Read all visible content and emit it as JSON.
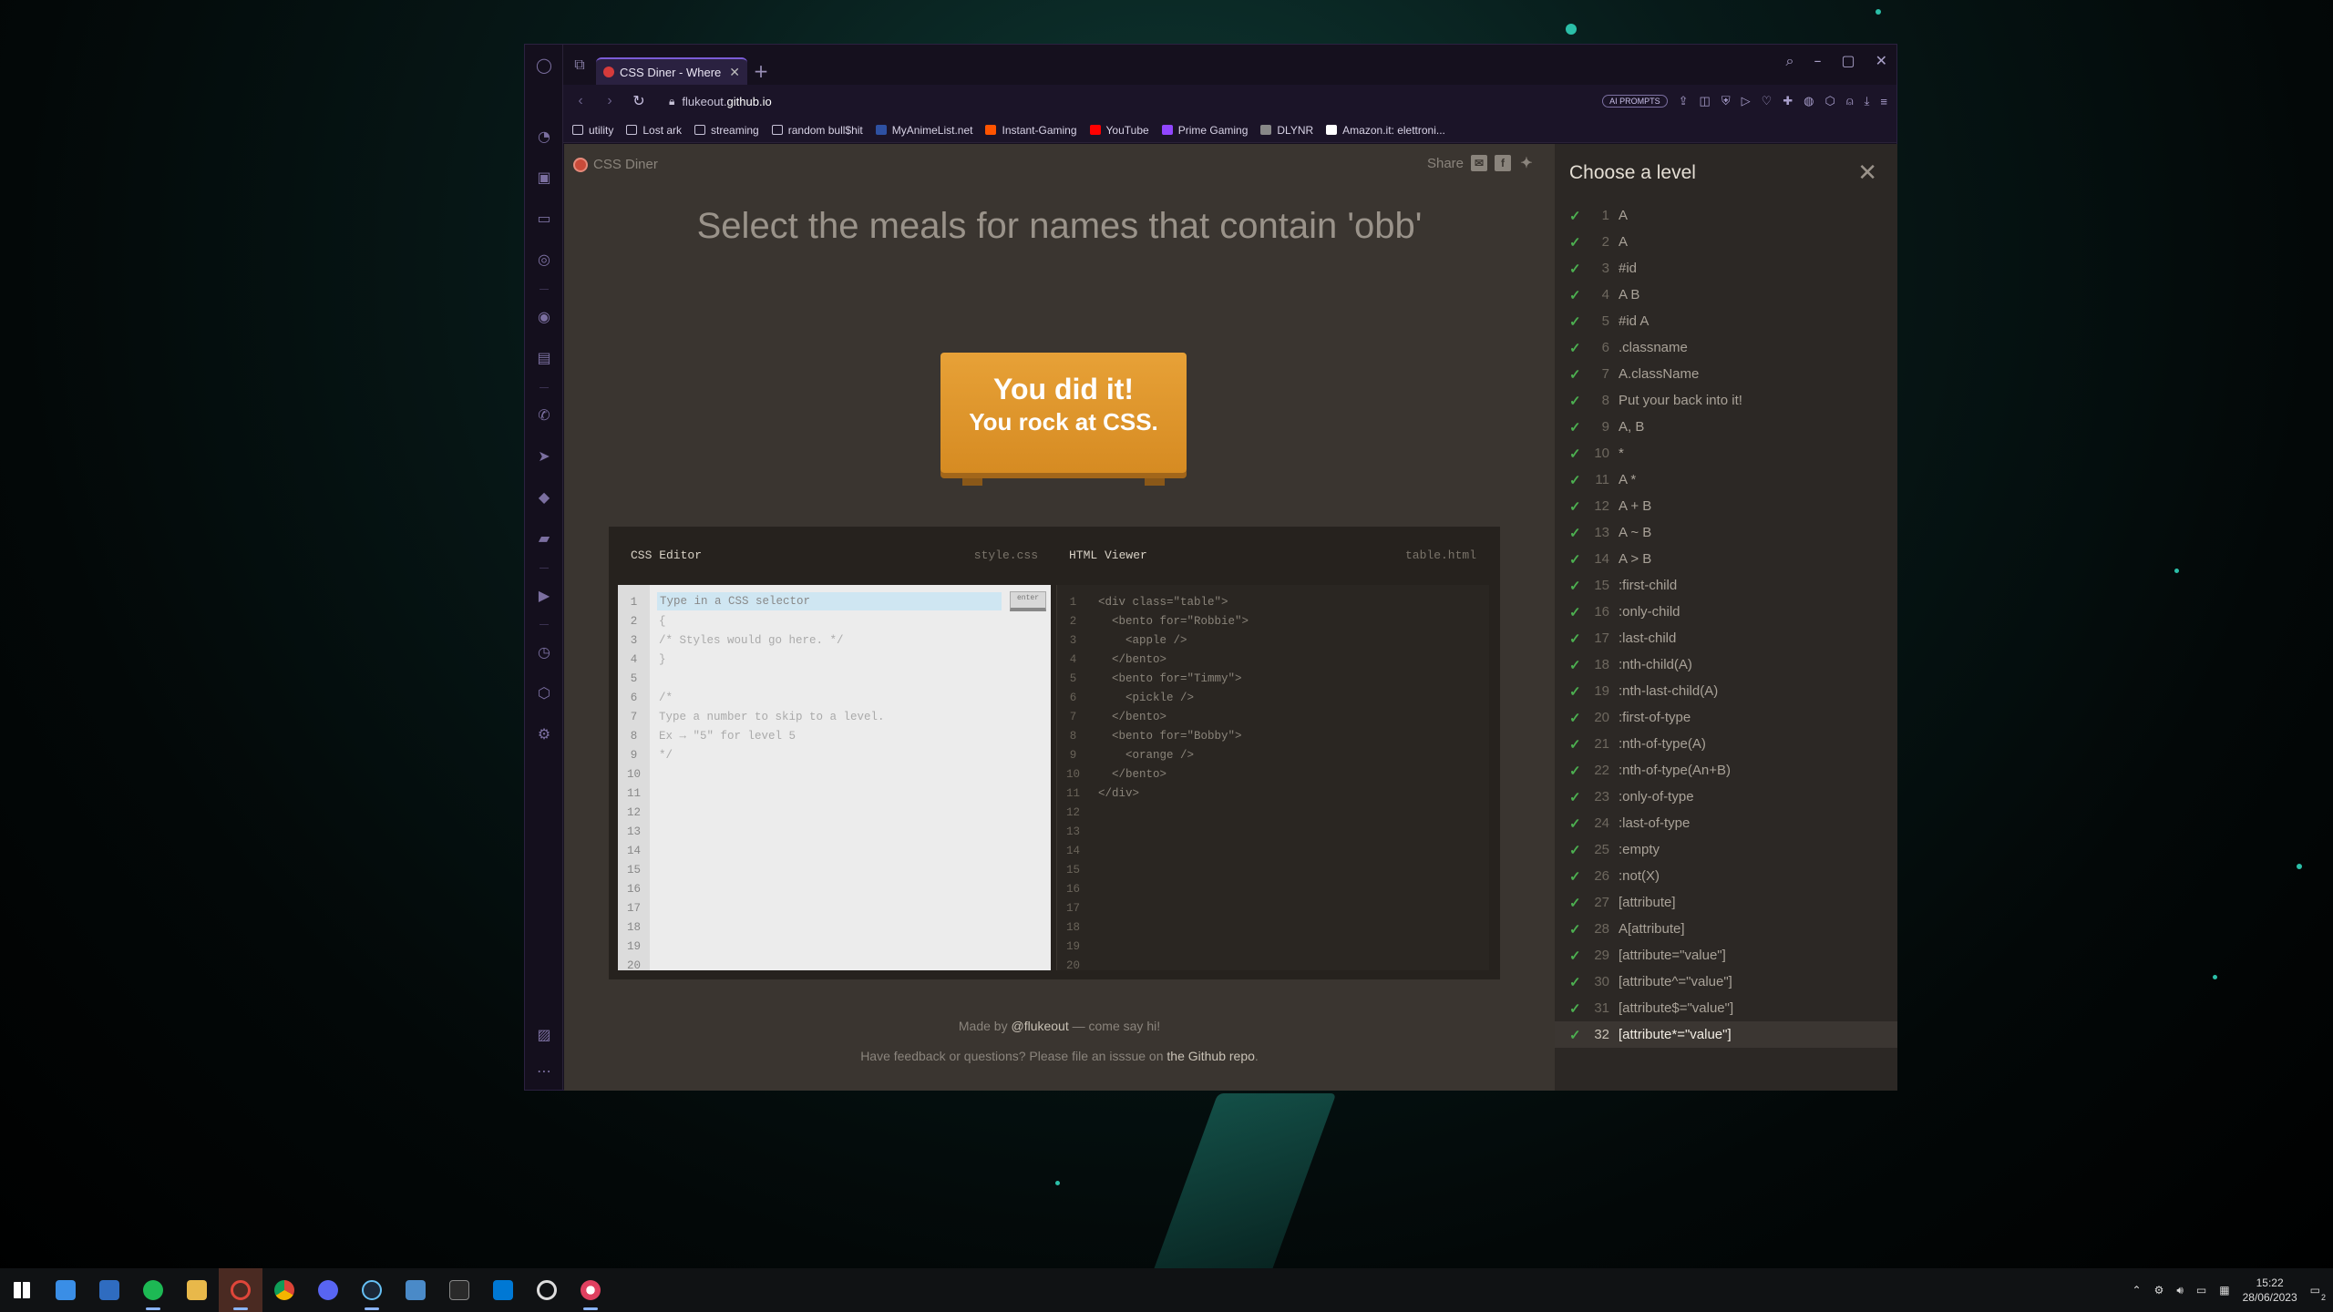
{
  "browser": {
    "tab_title": "CSS Diner - Where we feast",
    "url_prefix": "flukeout.",
    "url_domain": "github.io",
    "ai_prompts_label": "AI PROMPTS",
    "bookmarks": [
      {
        "label": "utility",
        "icon": "folder-icon"
      },
      {
        "label": "Lost ark",
        "icon": "folder-icon"
      },
      {
        "label": "streaming",
        "icon": "folder-icon"
      },
      {
        "label": "random bull$hit",
        "icon": "folder-icon"
      },
      {
        "label": "MyAnimeList.net",
        "icon": "mal-icon"
      },
      {
        "label": "Instant-Gaming",
        "icon": "instant-gaming-icon"
      },
      {
        "label": "YouTube",
        "icon": "youtube-icon"
      },
      {
        "label": "Prime Gaming",
        "icon": "prime-gaming-icon"
      },
      {
        "label": "DLYNR",
        "icon": "dlynr-icon"
      },
      {
        "label": "Amazon.it: elettroni...",
        "icon": "amazon-icon"
      }
    ]
  },
  "page": {
    "site_name": "CSS Diner",
    "share_label": "Share",
    "order_text": "Select the meals for names that contain 'obb'",
    "plate_line1": "You did it!",
    "plate_line2": "You rock at CSS.",
    "css_editor_title": "CSS Editor",
    "css_editor_file": "style.css",
    "html_viewer_title": "HTML Viewer",
    "html_viewer_file": "table.html",
    "input_placeholder": "Type in a CSS selector",
    "enter_label": "enter",
    "line_numbers": "1\n2\n3\n4\n5\n6\n7\n8\n9\n10\n11\n12\n13\n14\n15\n16\n17\n18\n19\n20",
    "css_code": "\n{\n/* Styles would go here. */\n}\n\n/*\nType a number to skip to a level.\nEx → \"5\" for level 5\n*/",
    "html_code": "<div class=\"table\">\n  <bento for=\"Robbie\">\n    <apple />\n  </bento>\n  <bento for=\"Timmy\">\n    <pickle />\n  </bento>\n  <bento for=\"Bobby\">\n    <orange />\n  </bento>\n</div>",
    "footer_made_by": "Made by ",
    "footer_author": "@flukeout",
    "footer_made_by_tail": " — come say hi!",
    "footer_feedback": "Have feedback or questions? Please file an isssue on ",
    "footer_repo": "the Github repo",
    "footer_period": "."
  },
  "levels": {
    "title": "Choose a level",
    "current": 32,
    "items": [
      {
        "num": "1",
        "label": "A"
      },
      {
        "num": "2",
        "label": "A"
      },
      {
        "num": "3",
        "label": "#id"
      },
      {
        "num": "4",
        "label": "A B"
      },
      {
        "num": "5",
        "label": "#id A"
      },
      {
        "num": "6",
        "label": ".classname"
      },
      {
        "num": "7",
        "label": "A.className"
      },
      {
        "num": "8",
        "label": "Put your back into it!"
      },
      {
        "num": "9",
        "label": "A, B"
      },
      {
        "num": "10",
        "label": "*"
      },
      {
        "num": "11",
        "label": "A *"
      },
      {
        "num": "12",
        "label": "A + B"
      },
      {
        "num": "13",
        "label": "A ~ B"
      },
      {
        "num": "14",
        "label": "A > B"
      },
      {
        "num": "15",
        "label": ":first-child"
      },
      {
        "num": "16",
        "label": ":only-child"
      },
      {
        "num": "17",
        "label": ":last-child"
      },
      {
        "num": "18",
        "label": ":nth-child(A)"
      },
      {
        "num": "19",
        "label": ":nth-last-child(A)"
      },
      {
        "num": "20",
        "label": ":first-of-type"
      },
      {
        "num": "21",
        "label": ":nth-of-type(A)"
      },
      {
        "num": "22",
        "label": ":nth-of-type(An+B)"
      },
      {
        "num": "23",
        "label": ":only-of-type"
      },
      {
        "num": "24",
        "label": ":last-of-type"
      },
      {
        "num": "25",
        "label": ":empty"
      },
      {
        "num": "26",
        "label": ":not(X)"
      },
      {
        "num": "27",
        "label": "[attribute]"
      },
      {
        "num": "28",
        "label": "A[attribute]"
      },
      {
        "num": "29",
        "label": "[attribute=\"value\"]"
      },
      {
        "num": "30",
        "label": "[attribute^=\"value\"]"
      },
      {
        "num": "31",
        "label": "[attribute$=\"value\"]"
      },
      {
        "num": "32",
        "label": "[attribute*=\"value\"]"
      }
    ]
  },
  "taskbar": {
    "time": "15:22",
    "date": "28/06/2023",
    "notification_count": "2"
  }
}
